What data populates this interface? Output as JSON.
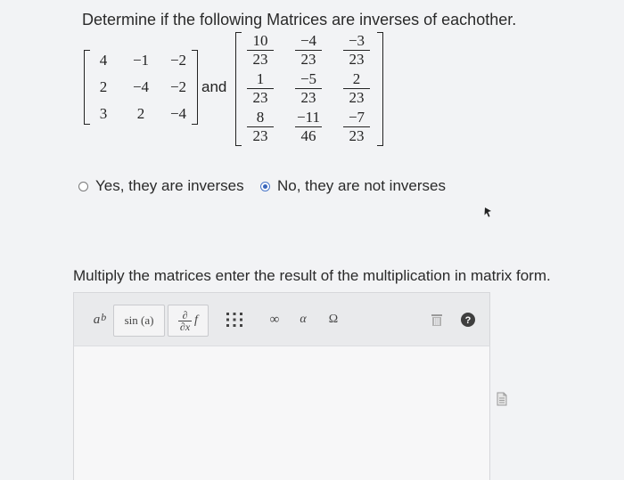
{
  "question": {
    "prompt": "Determine if the following Matrices are inverses of eachother.",
    "and_label": "and",
    "matrix_a": [
      [
        "4",
        "−1",
        "−2"
      ],
      [
        "2",
        "−4",
        "−2"
      ],
      [
        "3",
        "2",
        "−4"
      ]
    ],
    "matrix_b": [
      [
        {
          "num": "10",
          "den": "23"
        },
        {
          "num": "−4",
          "den": "23"
        },
        {
          "num": "−3",
          "den": "23"
        }
      ],
      [
        {
          "num": "1",
          "den": "23"
        },
        {
          "num": "−5",
          "den": "23"
        },
        {
          "num": "2",
          "den": "23"
        }
      ],
      [
        {
          "num": "8",
          "den": "23"
        },
        {
          "num": "−11",
          "den": "46"
        },
        {
          "num": "−7",
          "den": "23"
        }
      ]
    ]
  },
  "options": [
    {
      "label": "Yes, they are inverses",
      "selected": false
    },
    {
      "label": "No, they are not inverses",
      "selected": true
    }
  ],
  "instruction": "Multiply the matrices enter the result of the multiplication in matrix form.",
  "toolbar": {
    "power": {
      "base": "a",
      "exp": "b"
    },
    "sin_label": "sin (a)",
    "partial": {
      "num": "∂",
      "den": "∂x",
      "f": "f"
    },
    "infinity": "∞",
    "alpha": "α",
    "omega": "Ω"
  },
  "colors": {
    "radio_selected": "#3a66bb",
    "help": "#3f3f3f",
    "trash": "#9a9a9a"
  },
  "icons": [
    "matrix-icon",
    "trash-icon",
    "help-icon",
    "cursor-icon",
    "document-icon"
  ]
}
